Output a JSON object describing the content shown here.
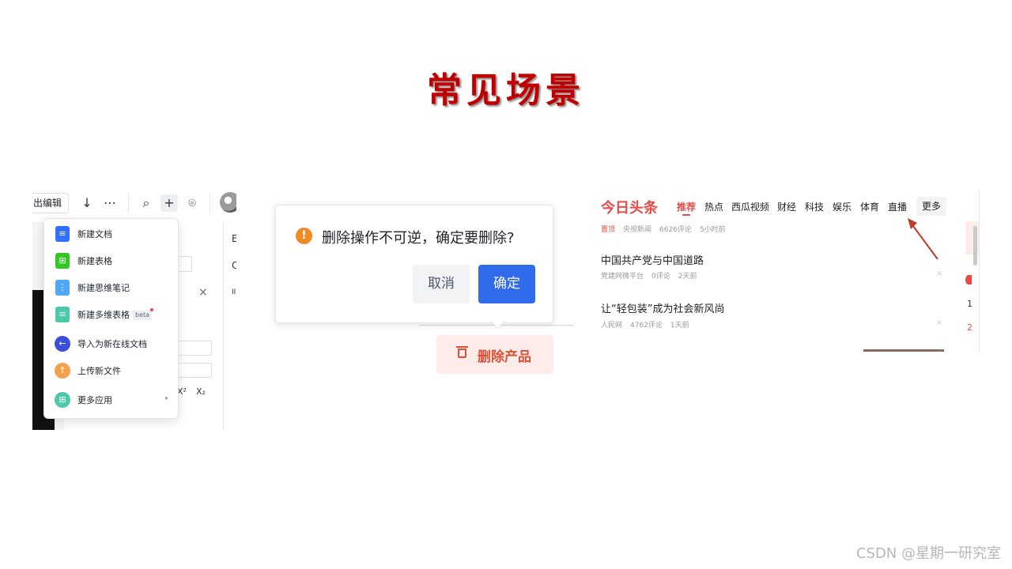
{
  "slide": {
    "title": "常见场景",
    "watermark": "CSDN @星期一研究室"
  },
  "doc_editor": {
    "toolbar": {
      "exit_edit_label": "出编辑",
      "download_icon": "↓",
      "more_icon": "⋯",
      "search_icon": "⌕",
      "add_icon": "+",
      "idea_icon": "⌾"
    },
    "side_letters": [
      "E",
      "C",
      "II"
    ],
    "close_glyph": "×",
    "superscript": "X²",
    "subscript": "X₂",
    "menu": [
      {
        "label": "新建文档",
        "icon": "doc-icon",
        "color": "#3370ff",
        "glyph": "≡"
      },
      {
        "label": "新建表格",
        "icon": "sheet-icon",
        "color": "#34c724",
        "glyph": "⊞"
      },
      {
        "label": "新建思维笔记",
        "icon": "mindnote-icon",
        "color": "#4fa8f5",
        "glyph": "⋮"
      },
      {
        "label": "新建多维表格",
        "icon": "bitable-icon",
        "color": "#4cc9a8",
        "glyph": "≡",
        "badge": "beta"
      },
      {
        "label": "导入为新在线文档",
        "icon": "import-icon",
        "color": "#3a4fd8",
        "glyph": "←"
      },
      {
        "label": "上传新文件",
        "icon": "upload-icon",
        "color": "#f5a04d",
        "glyph": "↑"
      },
      {
        "label": "更多应用",
        "icon": "apps-icon",
        "color": "#4cc9a8",
        "glyph": "⊞",
        "chevron": "▸"
      }
    ]
  },
  "popconfirm": {
    "warn_glyph": "!",
    "message": "删除操作不可逆，确定要删除?",
    "cancel_label": "取消",
    "confirm_label": "确定",
    "delete_button_label": "删除产品",
    "colors": {
      "primary": "#2f6bea",
      "danger": "#e04e35",
      "warning": "#f08a24"
    }
  },
  "toutiao": {
    "logo": "今日头条",
    "nav": [
      "推荐",
      "热点",
      "西瓜视频",
      "财经",
      "科技",
      "娱乐",
      "体育",
      "直播"
    ],
    "more_label": "更多",
    "feed_top_meta": {
      "tag": "置顶",
      "source": "央视新闻",
      "comments": "6626评论",
      "time": "5小时前"
    },
    "articles": [
      {
        "title": "中国共产党与中国道路",
        "source": "党建网微平台",
        "comments": "0评论",
        "time": "2天前"
      },
      {
        "title": "让“轻包装”成为社会新风尚",
        "source": "人民网",
        "comments": "4762评论",
        "time": "1天前"
      }
    ],
    "close_glyph": "×",
    "right_glyphs": [
      "1",
      "2"
    ],
    "accent": "#e84b45"
  }
}
